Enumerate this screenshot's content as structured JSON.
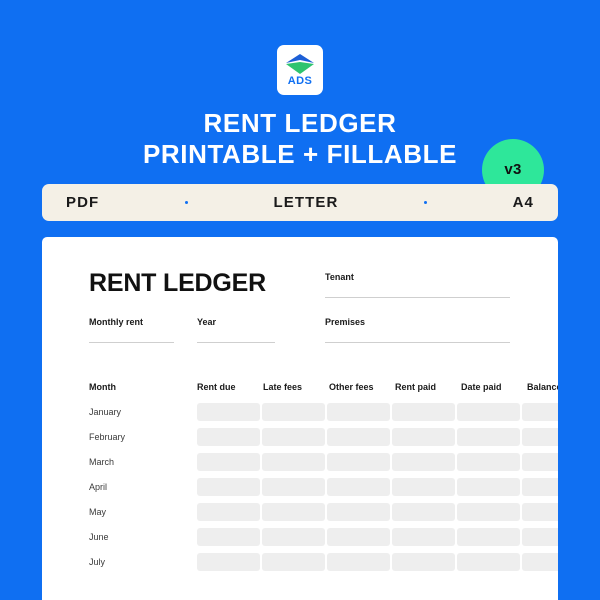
{
  "theme": {
    "background_blue": "#0f6ff2",
    "badge_green": "#2ee79a",
    "format_bar_beige": "#f4f0e6",
    "card_white": "#ffffff",
    "cell_gray": "#eeeeee"
  },
  "logo": {
    "icon_name": "ads-diamond-logo",
    "wordmark": "ADS"
  },
  "title": {
    "line1": "RENT LEDGER",
    "line2": "PRINTABLE + FILLABLE"
  },
  "badge": {
    "version_label": "v3"
  },
  "format_bar": {
    "items": [
      "PDF",
      "LETTER",
      "A4"
    ],
    "separator": "dot"
  },
  "document": {
    "title": "RENT LEDGER",
    "fields": [
      {
        "key": "tenant",
        "label": "Tenant",
        "value": ""
      },
      {
        "key": "premises",
        "label": "Premises",
        "value": ""
      },
      {
        "key": "monthly_rent",
        "label": "Monthly rent",
        "value": ""
      },
      {
        "key": "year",
        "label": "Year",
        "value": ""
      }
    ],
    "table": {
      "columns": [
        "Month",
        "Rent due",
        "Late fees",
        "Other fees",
        "Rent paid",
        "Date paid",
        "Balance"
      ],
      "rows": [
        {
          "month": "January",
          "values": [
            "",
            "",
            "",
            "",
            "",
            ""
          ]
        },
        {
          "month": "February",
          "values": [
            "",
            "",
            "",
            "",
            "",
            ""
          ]
        },
        {
          "month": "March",
          "values": [
            "",
            "",
            "",
            "",
            "",
            ""
          ]
        },
        {
          "month": "April",
          "values": [
            "",
            "",
            "",
            "",
            "",
            ""
          ]
        },
        {
          "month": "May",
          "values": [
            "",
            "",
            "",
            "",
            "",
            ""
          ]
        },
        {
          "month": "June",
          "values": [
            "",
            "",
            "",
            "",
            "",
            ""
          ]
        },
        {
          "month": "July",
          "values": [
            "",
            "",
            "",
            "",
            "",
            ""
          ]
        }
      ]
    }
  }
}
